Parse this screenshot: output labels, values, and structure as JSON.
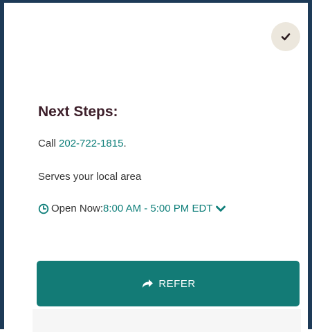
{
  "card": {
    "title": "Next Steps:",
    "call": {
      "prefix": "Call ",
      "phone": "202-722-1815",
      "suffix": "."
    },
    "serves": "Serves your local area",
    "hours": {
      "label": "Open Now: ",
      "time": "8:00 AM - 5:00 PM EDT"
    },
    "refer_label": "REFER"
  },
  "icons": {
    "check": "checkmark-icon",
    "clock": "clock-icon",
    "chevron": "chevron-down-icon",
    "share": "share-arrow-icon"
  },
  "colors": {
    "accent": "#137b76",
    "link": "#0f7f7a",
    "title": "#3d1f2a",
    "border": "#1d3a57",
    "check_bg": "#ece7dd"
  }
}
